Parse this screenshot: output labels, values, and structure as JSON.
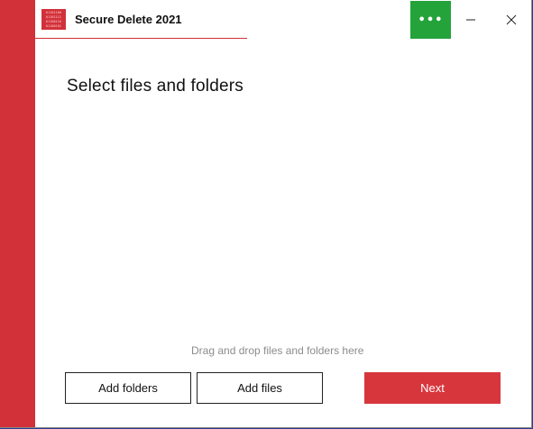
{
  "window": {
    "title": "Secure Delete 2021",
    "logo_lines": [
      "01101100",
      "01101111",
      "01100110",
      "01100101"
    ]
  },
  "titlebar": {
    "menu_label": "•••",
    "menu_icon": "more-dots-icon",
    "minimize_icon": "minimize-icon",
    "close_icon": "close-icon"
  },
  "main": {
    "heading": "Select files and folders",
    "drop_hint": "Drag and drop files and folders here"
  },
  "actions": {
    "add_folders": "Add folders",
    "add_files": "Add files",
    "next": "Next"
  },
  "colors": {
    "accent_red": "#d2313a",
    "menu_green": "#23a33a",
    "next_red": "#d8363d",
    "hint_gray": "#8c8c8c"
  }
}
